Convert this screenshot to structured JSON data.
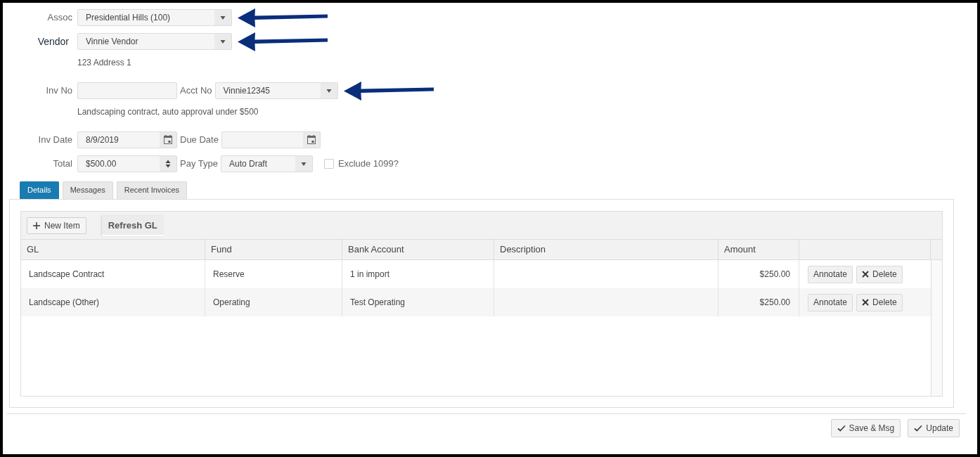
{
  "form": {
    "rows": [
      {
        "kind": "fields",
        "fields": [
          {
            "kind": "select",
            "label": "Assoc",
            "value": "Presidential Hills (100)",
            "arrow": true
          }
        ]
      },
      {
        "kind": "fields",
        "fields": [
          {
            "kind": "select",
            "label": "Vendor",
            "value": "Vinnie Vendor",
            "arrow": true
          }
        ]
      },
      {
        "kind": "note",
        "text": "123 Address 1"
      },
      {
        "kind": "fields",
        "fields": [
          {
            "kind": "text",
            "label": "Inv No"
          },
          {
            "kind": "select",
            "label": "Acct No",
            "value": "Vinnie12345",
            "arrow": true
          }
        ]
      },
      {
        "kind": "note",
        "text": "Landscaping contract, auto approval under $500"
      },
      {
        "kind": "fields",
        "fields": [
          {
            "kind": "date",
            "label": "Inv Date",
            "value": "8/9/2019"
          },
          {
            "kind": "date",
            "label": "Due Date"
          }
        ]
      },
      {
        "kind": "fields",
        "fields": [
          {
            "kind": "number",
            "label": "Total",
            "value": "$500.00"
          },
          {
            "kind": "select",
            "label": "Pay Type",
            "value": "Auto Draft"
          },
          {
            "kind": "checkbox",
            "label": "Exclude 1099?",
            "checked": false
          }
        ]
      }
    ]
  },
  "tabs": [
    {
      "label": "Details",
      "selected": true
    },
    {
      "label": "Messages",
      "selected": false
    },
    {
      "label": "Recent Invoices",
      "selected": false
    }
  ],
  "details": {
    "toolbar": [
      {
        "kind": "add",
        "label": "New Item"
      },
      {
        "kind": "refresh",
        "label": "Refresh GL"
      }
    ],
    "table": {
      "columns": [
        "GL",
        "Fund",
        "Bank Account",
        "Description",
        "Amount"
      ],
      "rows": [
        {
          "gl": "Landscape Contract",
          "fund": "Reserve",
          "bank_account": "1 in import",
          "amount": "$250.00",
          "actions": [
            {
              "kind": "annotate",
              "label": "Annotate"
            },
            {
              "kind": "delete",
              "label": "Delete"
            }
          ]
        },
        {
          "gl": "Landscape (Other)",
          "fund": "Operating",
          "bank_account": "Test Operating",
          "amount": "$250.00",
          "actions": [
            {
              "kind": "annotate",
              "label": "Annotate"
            },
            {
              "kind": "delete",
              "label": "Delete"
            }
          ]
        }
      ]
    }
  },
  "footer": {
    "buttons": [
      {
        "kind": "confirm",
        "label": "Save & Msg"
      },
      {
        "kind": "confirm",
        "label": "Update"
      }
    ]
  }
}
